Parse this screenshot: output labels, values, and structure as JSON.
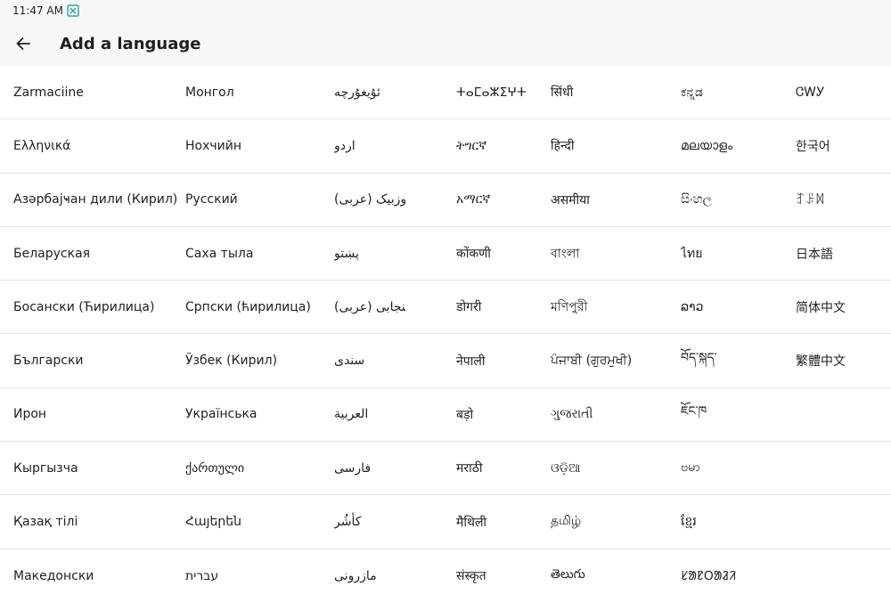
{
  "status_bar": {
    "time": "11:47 AM",
    "notification_icon": "x-box-icon"
  },
  "app_bar": {
    "back_icon": "arrow-back-icon",
    "title": "Add a language"
  },
  "languages": [
    [
      "Zarmaciine",
      "Монгол",
      "ئۇيغۇرچە",
      "ⵜⴰⵎⴰⵣⵉⵖⵜ",
      "सिंधी",
      "ಕನ್ನಡ",
      "ᏣᎳᎩ"
    ],
    [
      "Ελληνικά",
      "Нохчийн",
      "اردو",
      "ትግርኛ",
      "हिन्दी",
      "മലയാളം",
      "한국어"
    ],
    [
      "Азәрбајҹан дили (Кирил)",
      "Русский",
      "اوزبیک (عربی)",
      "አማርኛ",
      "असमीया",
      "සිංහල",
      "ꆈꌠꉙ"
    ],
    [
      "Беларуская",
      "Саха тыла",
      "پښتو",
      "कोंकणी",
      "বাংলা",
      "ไทย",
      "日本語"
    ],
    [
      "Босански (Ћирилица)",
      "Српски (ћирилица)",
      "پنجابی (عربی)",
      "डोगरी",
      "মণিপুরী",
      "ລາວ",
      "简体中文"
    ],
    [
      "Български",
      "Ўзбек (Кирил)",
      "سندی",
      "नेपाली",
      "ਪੰਜਾਬੀ (ਗੁਰਮੁਖੀ)",
      "བོད་སྐད་",
      "繁體中文"
    ],
    [
      "Ирон",
      "Українська",
      "العربية",
      "बड़ो",
      "ગુજરાતી",
      "ཇོང་ཁ",
      ""
    ],
    [
      "Кыргызча",
      "ქართული",
      "فارسی",
      "मराठी",
      "ଓଡ଼ିଆ",
      "ဗမာ",
      ""
    ],
    [
      "Қазақ тілі",
      "Հայերեն",
      "کأشُر",
      "मैथिली",
      "தமிழ்",
      "ខ្មែរ",
      ""
    ],
    [
      "Македонски",
      "עברית",
      "مازرونی",
      "संस्कृत",
      "తెలుగు",
      "ᱥᱟᱱᱛᱟᱲᱤ",
      ""
    ]
  ]
}
